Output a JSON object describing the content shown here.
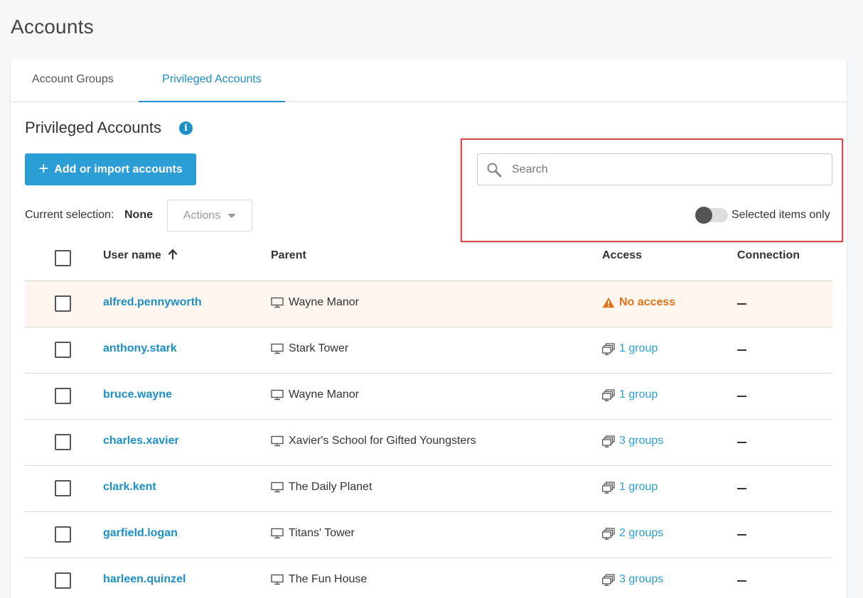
{
  "page": {
    "title": "Accounts"
  },
  "tabs": [
    {
      "label": "Account Groups",
      "active": false
    },
    {
      "label": "Privileged Accounts",
      "active": true
    }
  ],
  "section": {
    "title": "Privileged Accounts",
    "info_icon": "info-icon",
    "add_button_label": "Add or import accounts",
    "selection_label": "Current selection:",
    "selection_value": "None",
    "actions_label": "Actions"
  },
  "search": {
    "placeholder": "Search",
    "value": ""
  },
  "toggle": {
    "label": "Selected items only",
    "on": false
  },
  "colors": {
    "accent": "#1c8fc6",
    "button": "#2b9ed6",
    "warning": "#e0731a",
    "highlight": "#e0484d",
    "warn_row_bg": "#fef6ef"
  },
  "table": {
    "headers": {
      "user": "User name",
      "parent": "Parent",
      "access": "Access",
      "connection": "Connection"
    },
    "sort": {
      "column": "User name",
      "direction": "ascending"
    },
    "rows": [
      {
        "user": "alfred.pennyworth",
        "parent": "Wayne Manor",
        "access": "No access",
        "access_type": "warning",
        "connection": "—"
      },
      {
        "user": "anthony.stark",
        "parent": "Stark Tower",
        "access": "1 group",
        "access_type": "link",
        "connection": "—"
      },
      {
        "user": "bruce.wayne",
        "parent": "Wayne Manor",
        "access": "1 group",
        "access_type": "link",
        "connection": "—"
      },
      {
        "user": "charles.xavier",
        "parent": "Xavier's School for Gifted Youngsters",
        "access": "3 groups",
        "access_type": "link",
        "connection": "—"
      },
      {
        "user": "clark.kent",
        "parent": "The Daily Planet",
        "access": "1 group",
        "access_type": "link",
        "connection": "—"
      },
      {
        "user": "garfield.logan",
        "parent": "Titans' Tower",
        "access": "2 groups",
        "access_type": "link",
        "connection": "—"
      },
      {
        "user": "harleen.quinzel",
        "parent": "The Fun House",
        "access": "3 groups",
        "access_type": "link",
        "connection": "—"
      }
    ]
  }
}
